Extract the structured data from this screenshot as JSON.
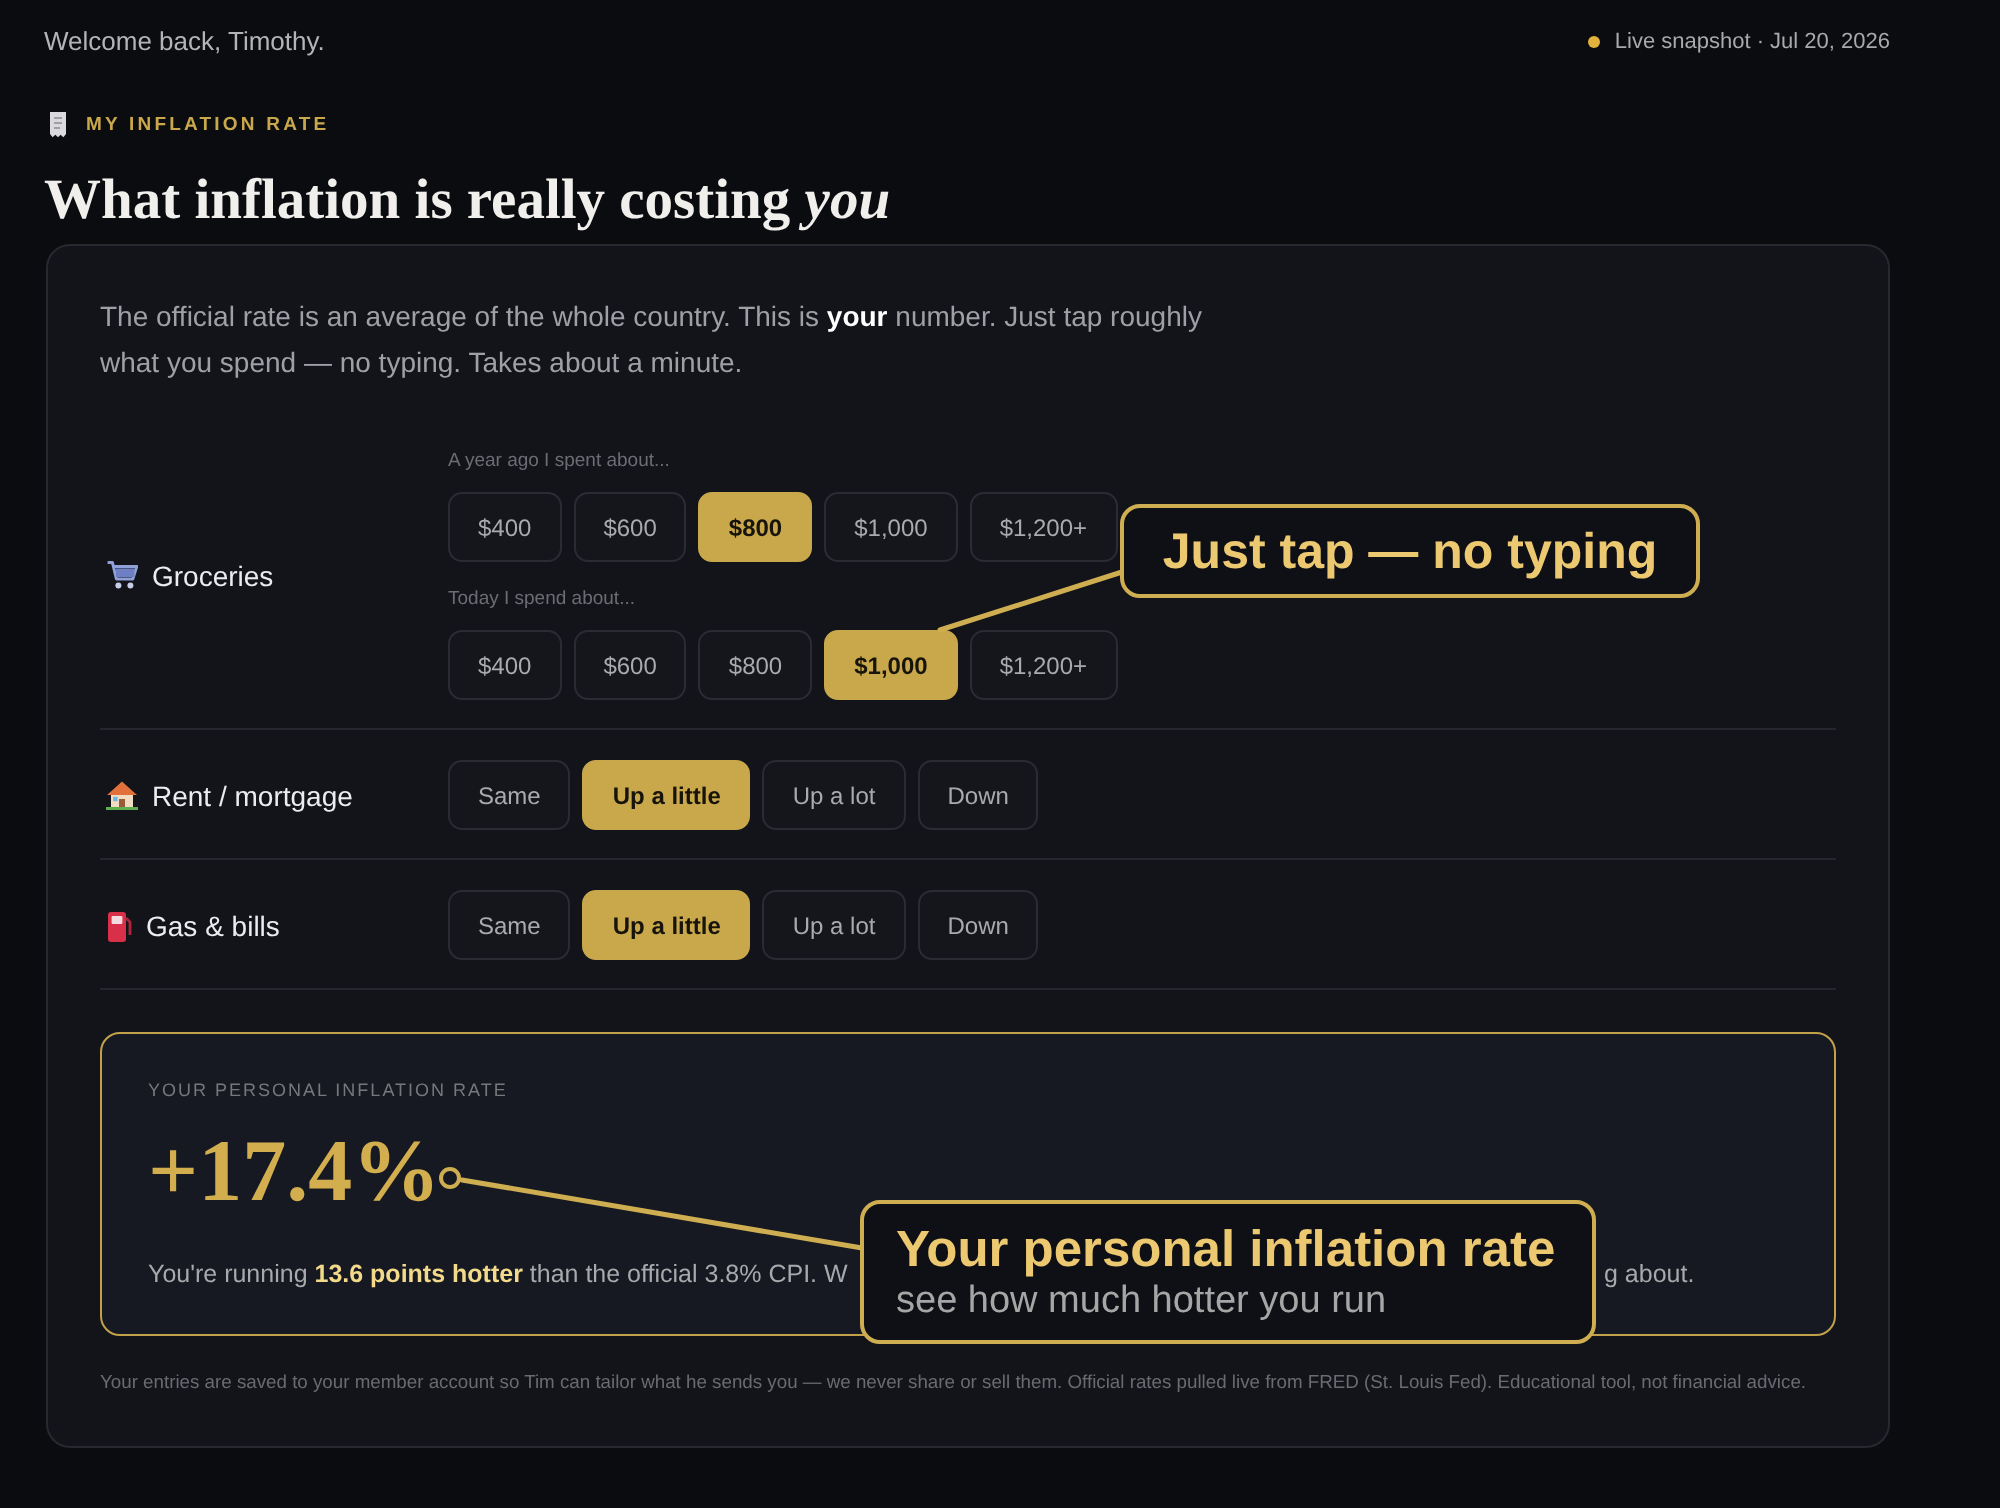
{
  "header": {
    "greeting": "Welcome back, Timothy.",
    "snapshot": "Live snapshot · Jul 20, 2026"
  },
  "eyebrow": "MY INFLATION RATE",
  "title": "What inflation is really costing *you*",
  "intro": "The official rate is an average of the whole country. This is **your** number. Just tap roughly what you spend — no typing. Takes about a minute.",
  "categories": [
    {
      "label": "Groceries",
      "groups": [
        {
          "prompt": "A year ago I spent about...",
          "options": [
            {
              "label": "$400",
              "selected": false
            },
            {
              "label": "$600",
              "selected": false
            },
            {
              "label": "$800",
              "selected": true
            },
            {
              "label": "$1,000",
              "selected": false
            },
            {
              "label": "$1,200+",
              "selected": false
            }
          ]
        },
        {
          "prompt": "Today I spend about...",
          "options": [
            {
              "label": "$400",
              "selected": false
            },
            {
              "label": "$600",
              "selected": false
            },
            {
              "label": "$800",
              "selected": false
            },
            {
              "label": "$1,000",
              "selected": true
            },
            {
              "label": "$1,200+",
              "selected": false
            }
          ]
        }
      ]
    },
    {
      "label": "Rent / mortgage",
      "groups": [
        {
          "options": [
            {
              "label": "Same",
              "selected": false
            },
            {
              "label": "Up a little",
              "selected": true
            },
            {
              "label": "Up a lot",
              "selected": false
            },
            {
              "label": "Down",
              "selected": false
            }
          ]
        }
      ]
    },
    {
      "label": "Gas & bills",
      "groups": [
        {
          "options": [
            {
              "label": "Same",
              "selected": false
            },
            {
              "label": "Up a little",
              "selected": true
            },
            {
              "label": "Up a lot",
              "selected": false
            },
            {
              "label": "Down",
              "selected": false
            }
          ]
        }
      ]
    }
  ],
  "result": {
    "heading": "YOUR PERSONAL INFLATION RATE",
    "rate": "+17.4%",
    "comparison_visible_start": "You're running **13.6 points hotter** than the official 3.8% CPI. W",
    "comparison_visible_end": "g about."
  },
  "footer": "Your entries are saved to your member account so Tim can tailor what he sends you — we never share or sell them. Official rates pulled live from FRED (St. Louis Fed). Educational tool, not financial advice.",
  "annotations": [
    {
      "title": "Just tap — no typing"
    },
    {
      "title": "Your personal inflation rate",
      "subtitle": "see how much hotter you run"
    }
  ]
}
